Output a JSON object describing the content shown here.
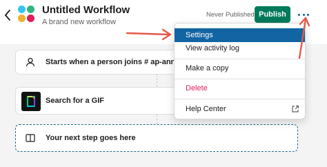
{
  "header": {
    "title": "Untitled Workflow",
    "subtitle": "A brand new workflow",
    "status": "Never Published",
    "publish_label": "Publish",
    "more_icon": "ellipsis-icon",
    "back_icon": "chevron-left-icon"
  },
  "steps": [
    {
      "label_prefix": "Starts when a person joins ",
      "channel": "# ap-announce",
      "icon": "person-icon"
    },
    {
      "label": "Search for a GIF",
      "icon": "gif-app-icon"
    },
    {
      "label": "Your next step goes here",
      "icon": "book-icon"
    }
  ],
  "menu": {
    "items": [
      {
        "label": "Settings",
        "selected": true
      },
      {
        "label": "View activity log"
      },
      {
        "label": "Make a copy"
      },
      {
        "label": "Delete",
        "danger": true
      },
      {
        "label": "Help Center",
        "icon": "external-link-icon"
      }
    ]
  },
  "colors": {
    "publish": "#007a5a",
    "selected": "#1264a3",
    "danger": "#e01e5a",
    "arrow": "#e8574a"
  }
}
